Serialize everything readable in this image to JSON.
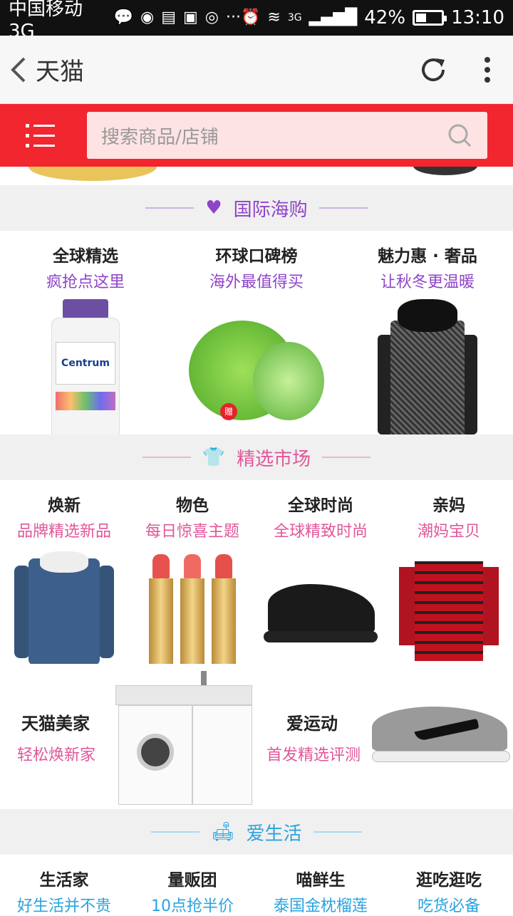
{
  "status_bar": {
    "carrier": "中国移动 3G",
    "network": "3G",
    "battery": "42%",
    "time": "13:10",
    "battery_level": 0.42
  },
  "nav": {
    "title": "天猫"
  },
  "search": {
    "placeholder": "搜索商品/店铺"
  },
  "sections": {
    "global": {
      "title": "国际海购",
      "color": "#8e44c8",
      "items": [
        {
          "title": "全球精选",
          "subtitle": "疯抢点这里"
        },
        {
          "title": "环球口碑榜",
          "subtitle": "海外最值得买"
        },
        {
          "title": "魅力惠 · 奢品",
          "subtitle": "让秋冬更温暖"
        }
      ],
      "product_text": {
        "bottle_brand": "Centrum",
        "gift_tag": "赠"
      }
    },
    "market": {
      "title": "精选市场",
      "color": "#e0579a",
      "items": [
        {
          "title": "焕新",
          "subtitle": "品牌精选新品"
        },
        {
          "title": "物色",
          "subtitle": "每日惊喜主题"
        },
        {
          "title": "全球时尚",
          "subtitle": "全球精致时尚"
        },
        {
          "title": "亲妈",
          "subtitle": "潮妈宝贝"
        }
      ],
      "promos": [
        {
          "title": "天猫美家",
          "subtitle": "轻松焕新家"
        },
        {
          "title": "爱运动",
          "subtitle": "首发精选评测"
        }
      ]
    },
    "life": {
      "title": "爱生活",
      "color": "#2aa3e0",
      "items": [
        {
          "title": "生活家",
          "subtitle": "好生活并不贵"
        },
        {
          "title": "量贩团",
          "subtitle": "10点抢半价"
        },
        {
          "title": "喵鲜生",
          "subtitle": "泰国金枕榴莲"
        },
        {
          "title": "逛吃逛吃",
          "subtitle": "吃货必备"
        }
      ]
    }
  },
  "colors": {
    "header_red": "#f1262e",
    "purple": "#8e44c8",
    "pink": "#e0579a",
    "blue": "#2aa3e0"
  }
}
